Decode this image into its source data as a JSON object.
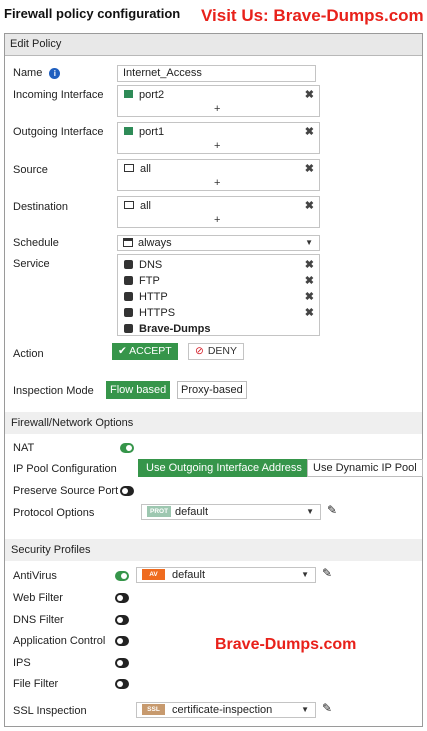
{
  "page": {
    "doc_title": "Firewall policy configuration",
    "watermark_top": "Visit Us: Brave-Dumps.com",
    "watermark_mid": "Brave-Dumps.com"
  },
  "panel": {
    "header": "Edit Policy",
    "name": {
      "label": "Name",
      "value": "Internet_Access",
      "info_icon": "info-icon"
    },
    "incoming": {
      "label": "Incoming Interface",
      "value": "port2",
      "add": "+"
    },
    "outgoing": {
      "label": "Outgoing Interface",
      "value": "port1",
      "add": "+"
    },
    "source": {
      "label": "Source",
      "value": "all",
      "add": "+"
    },
    "destination": {
      "label": "Destination",
      "value": "all",
      "add": "+"
    },
    "schedule": {
      "label": "Schedule",
      "value": "always"
    },
    "service": {
      "label": "Service",
      "items": [
        "DNS",
        "FTP",
        "HTTP",
        "HTTPS"
      ],
      "overlay": "Brave-Dumps"
    },
    "action": {
      "label": "Action",
      "accept": "✔ ACCEPT",
      "deny": "DENY",
      "deny_glyph": "⊘"
    },
    "inspection": {
      "label": "Inspection Mode",
      "flow": "Flow based",
      "proxy": "Proxy-based"
    }
  },
  "fw_options": {
    "header": "Firewall/Network Options",
    "nat": {
      "label": "NAT",
      "state": "on"
    },
    "ip_pool": {
      "label": "IP Pool Configuration",
      "outgoing": "Use Outgoing Interface Address",
      "dynamic": "Use Dynamic IP Pool"
    },
    "preserve_port": {
      "label": "Preserve Source Port",
      "state": "off"
    },
    "protocol_options": {
      "label": "Protocol Options",
      "badge": "PROT",
      "value": "default"
    }
  },
  "security": {
    "header": "Security Profiles",
    "antivirus": {
      "label": "AntiVirus",
      "state": "on",
      "badge": "AV",
      "value": "default"
    },
    "web_filter": {
      "label": "Web Filter",
      "state": "off"
    },
    "dns_filter": {
      "label": "DNS Filter",
      "state": "off"
    },
    "app_control": {
      "label": "Application Control",
      "state": "off"
    },
    "ips": {
      "label": "IPS",
      "state": "off"
    },
    "file_filter": {
      "label": "File Filter",
      "state": "off"
    },
    "ssl": {
      "label": "SSL Inspection",
      "badge": "SSL",
      "value": "certificate-inspection"
    }
  },
  "colors": {
    "accent_green": "#36954a",
    "watermark_red": "#e8211a",
    "av_badge": "#ef6b1f",
    "ssl_badge": "#c79a6e",
    "prot_badge": "#9dc7b0"
  },
  "icons": {
    "remove": "✖",
    "caret": "▼",
    "edit": "✎"
  }
}
